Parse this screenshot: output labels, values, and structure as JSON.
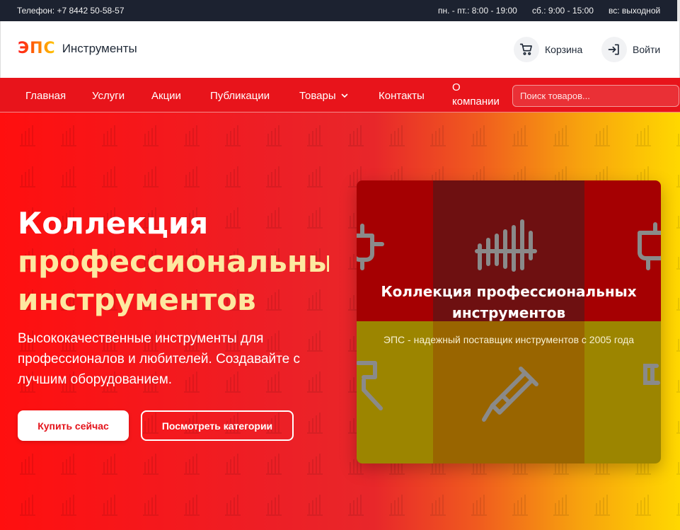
{
  "topbar": {
    "phone": "Телефон: +7 8442 50-58-57",
    "hours_weekdays": "пн. - пт.: 8:00 - 19:00",
    "hours_saturday": "сб.: 9:00 - 15:00",
    "hours_sunday": "вс: выходной"
  },
  "header": {
    "logo_mark": "ЭПС",
    "logo_name": "Инструменты",
    "cart_label": "Корзина",
    "login_label": "Войти"
  },
  "nav": {
    "items": [
      "Главная",
      "Услуги",
      "Акции",
      "Публикации",
      "Товары",
      "Контакты",
      "О компании"
    ],
    "search_placeholder": "Поиск товаров..."
  },
  "hero": {
    "title_line1": "Коллекция",
    "title_line2": "профессиональных",
    "title_line3": "инструментов",
    "description": "Высококачественные инструменты для профессионалов и любителей. Создавайте с лучшим оборудованием.",
    "buy_button": "Купить сейчас",
    "categories_button": "Посмотреть категории"
  },
  "card": {
    "title": "Коллекция профессиональных инструментов",
    "subtitle": "ЭПС - надежный поставщик инструментов с 2005 года",
    "icons": [
      "plug-icon",
      "fence-icon",
      "socket-icon",
      "wrench-icon",
      "screwdriver-icon"
    ]
  },
  "colors": {
    "nav_red": "#e8141b",
    "topbar_dark": "#1c2230",
    "accent_yellow": "#ffd800",
    "title_yellow": "#fde8a0"
  }
}
